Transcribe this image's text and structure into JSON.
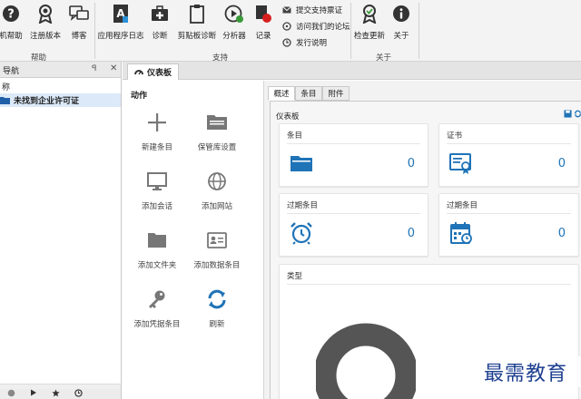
{
  "ribbon": {
    "groups": [
      {
        "label": "帮助"
      },
      {
        "label": "支持"
      },
      {
        "label": "关于"
      }
    ],
    "buttons": {
      "help": "机帮助",
      "register": "注册版本",
      "blog": "博客",
      "app_log": "应用程序日志",
      "diagnose": "诊断",
      "clipboard_diag": "剪贴板诊断",
      "analyzer": "分析器",
      "record": "记录",
      "check_update": "检查更新",
      "about": "关于"
    },
    "support_links": [
      "提交支持票证",
      "访问我们的论坛",
      "发行说明"
    ]
  },
  "nav": {
    "title": "导航",
    "pin": "ꟼ",
    "close": "✕",
    "column_header": "称",
    "tree_item": "未找到企业许可证"
  },
  "document_tab": {
    "label": "仪表板"
  },
  "actions": {
    "title": "动作",
    "items": [
      {
        "label": "新建条目",
        "icon": "plus-icon"
      },
      {
        "label": "保管库设置",
        "icon": "folder-settings-icon"
      },
      {
        "label": "添加会话",
        "icon": "monitor-icon"
      },
      {
        "label": "添加网站",
        "icon": "globe-icon"
      },
      {
        "label": "添加文件夹",
        "icon": "folder-icon"
      },
      {
        "label": "添加数据条目",
        "icon": "id-card-icon"
      },
      {
        "label": "添加凭据条目",
        "icon": "key-icon"
      },
      {
        "label": "刷新",
        "icon": "refresh-icon"
      }
    ]
  },
  "dashboard": {
    "tabs": [
      "概述",
      "条目",
      "附件"
    ],
    "active_tab": "概述",
    "title": "仪表板",
    "cards": [
      {
        "title": "条目",
        "value": "0",
        "icon": "folder-icon"
      },
      {
        "title": "证书",
        "value": "0",
        "icon": "certificate-icon"
      },
      {
        "title": "过期条目",
        "value": "0",
        "icon": "alarm-clock-icon"
      },
      {
        "title": "过期条目",
        "value": "0",
        "icon": "calendar-icon"
      }
    ],
    "types_card": {
      "title": "类型"
    }
  },
  "watermark": "最需教育",
  "colors": {
    "accent_blue": "#1f73b7",
    "ribbon_bg": "#f3f3f3",
    "selection": "#dbe9f8",
    "donut": "#555555"
  }
}
